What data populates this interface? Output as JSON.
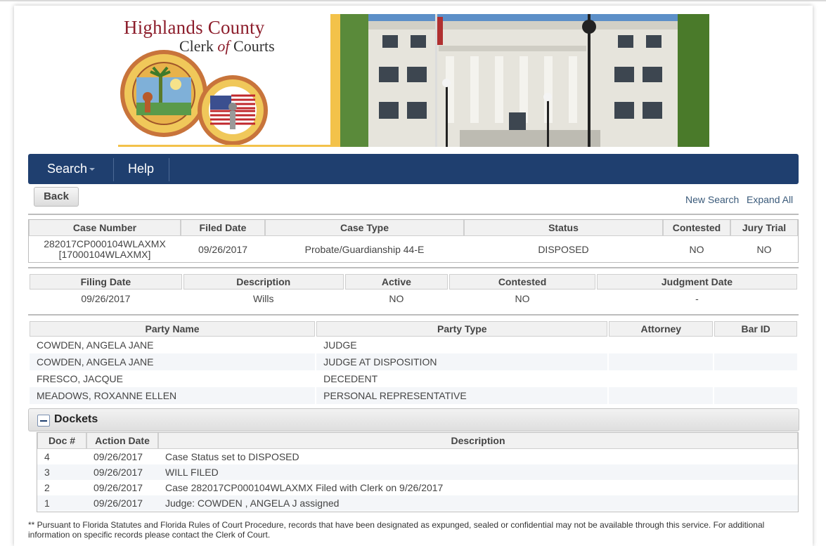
{
  "header": {
    "title": "Highlands County",
    "subtitle_prefix": "Clerk ",
    "subtitle_of": "of",
    "subtitle_suffix": " Courts"
  },
  "nav": {
    "search_label": "Search",
    "help_label": "Help"
  },
  "actions": {
    "back_label": "Back",
    "new_search_label": "New Search",
    "expand_all_label": "Expand All"
  },
  "case": {
    "headers": [
      "Case Number",
      "Filed Date",
      "Case Type",
      "Status",
      "Contested",
      "Jury Trial"
    ],
    "case_number": "282017CP000104WLAXMX",
    "case_number_alt": "[17000104WLAXMX]",
    "filed_date": "09/26/2017",
    "case_type": "Probate/Guardianship 44-E",
    "status": "DISPOSED",
    "contested": "NO",
    "jury_trial": "NO"
  },
  "filing": {
    "headers": [
      "Filing Date",
      "Description",
      "Active",
      "Contested",
      "Judgment Date"
    ],
    "row": [
      "09/26/2017",
      "Wills",
      "NO",
      "NO",
      "-"
    ]
  },
  "parties": {
    "headers": [
      "Party Name",
      "Party Type",
      "Attorney",
      "Bar ID"
    ],
    "rows": [
      {
        "name": "COWDEN, ANGELA JANE",
        "type": "JUDGE",
        "attorney": "",
        "bar_id": ""
      },
      {
        "name": "COWDEN, ANGELA JANE",
        "type": "JUDGE AT DISPOSITION",
        "attorney": "",
        "bar_id": ""
      },
      {
        "name": "FRESCO, JACQUE",
        "type": "DECEDENT",
        "attorney": "",
        "bar_id": ""
      },
      {
        "name": "MEADOWS, ROXANNE ELLEN",
        "type": "PERSONAL REPRESENTATIVE",
        "attorney": "",
        "bar_id": ""
      }
    ]
  },
  "dockets": {
    "title": "Dockets",
    "headers": [
      "Doc #",
      "Action Date",
      "Description"
    ],
    "rows": [
      {
        "doc": "4",
        "date": "09/26/2017",
        "description": "Case Status set to DISPOSED"
      },
      {
        "doc": "3",
        "date": "09/26/2017",
        "description": "WILL FILED"
      },
      {
        "doc": "2",
        "date": "09/26/2017",
        "description": "Case 282017CP000104WLAXMX Filed with Clerk on 9/26/2017"
      },
      {
        "doc": "1",
        "date": "09/26/2017",
        "description": "Judge: COWDEN , ANGELA J assigned"
      }
    ]
  },
  "footnote": "** Pursuant to Florida Statutes and Florida Rules of Court Procedure, records that have been designated as expunged, sealed or confidential may not be available through this service. For additional information on specific records please contact the Clerk of Court.",
  "colors": {
    "nav_bg": "#1f3f6f",
    "brand_red": "#8c1d2b",
    "accent_gold": "#f3c24a",
    "link": "#3a5a7a"
  }
}
